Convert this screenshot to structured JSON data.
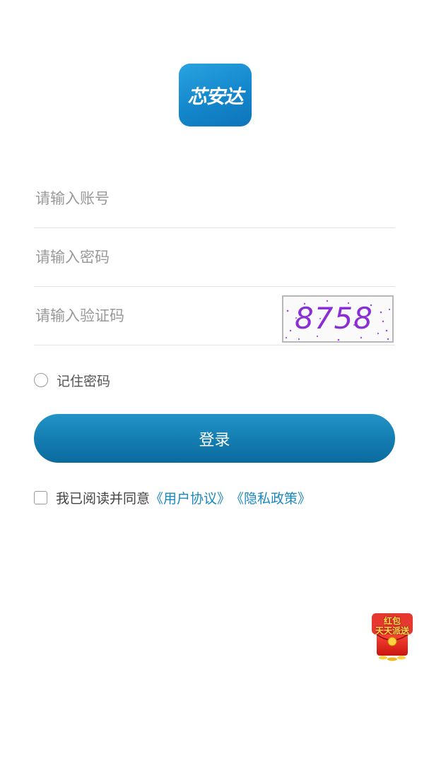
{
  "logo": {
    "text": "芯安达",
    "color": "#1a8fd4"
  },
  "form": {
    "account_placeholder": "请输入账号",
    "password_placeholder": "请输入密码",
    "captcha_placeholder": "请输入验证码",
    "captcha_code": "8758"
  },
  "remember": {
    "label": "记住密码",
    "checked": false
  },
  "login": {
    "label": "登录",
    "color": "#137cb1"
  },
  "agreement": {
    "checked": false,
    "prefix": "我已阅读并同意",
    "user_agreement": "《用户协议》",
    "privacy_policy": "《隐私政策》",
    "link_color": "#1a88c0"
  },
  "promo": {
    "line1": "红包",
    "line2": "天天派送"
  }
}
